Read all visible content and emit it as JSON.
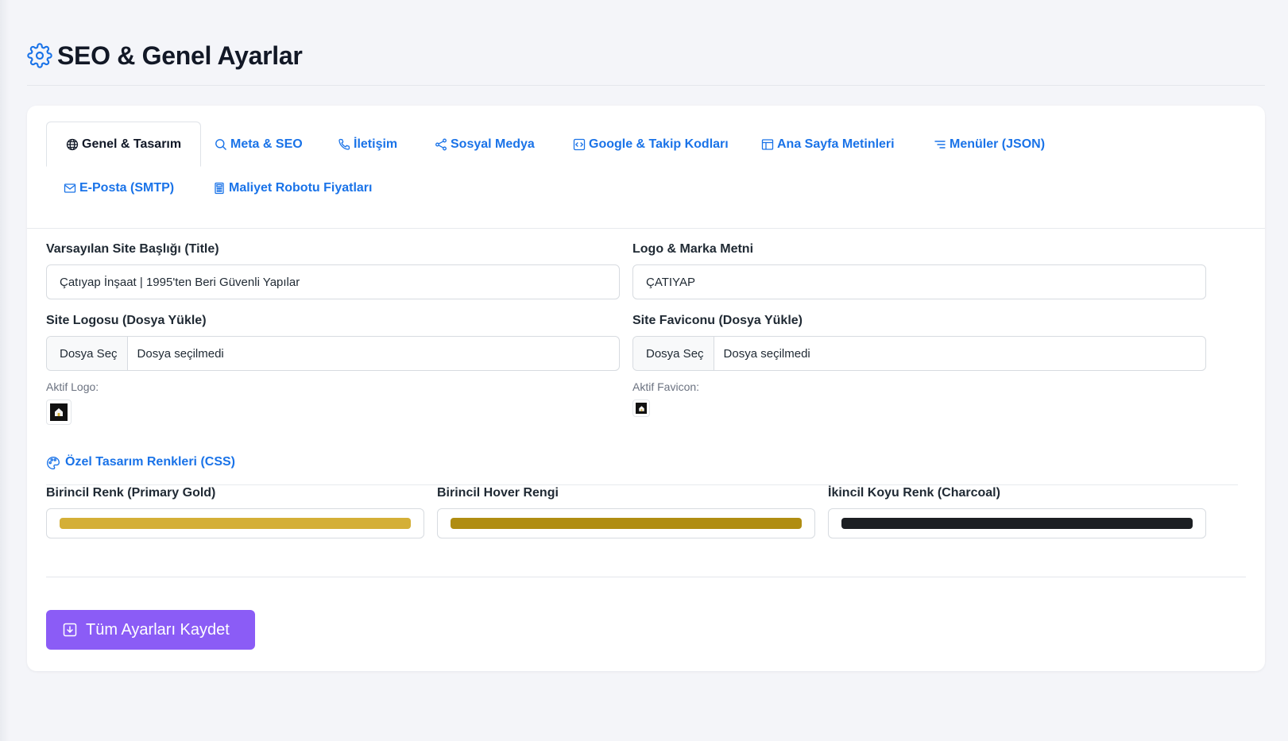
{
  "page": {
    "title": "SEO & Genel Ayarlar",
    "title_icon": "gear-icon"
  },
  "tabs": [
    {
      "label": "Genel & Tasarım",
      "icon": "globe-icon",
      "active": true
    },
    {
      "label": "Meta & SEO",
      "icon": "search-icon",
      "active": false
    },
    {
      "label": "İletişim",
      "icon": "phone-icon",
      "active": false
    },
    {
      "label": "Sosyal Medya",
      "icon": "share-icon",
      "active": false
    },
    {
      "label": "Google & Takip Kodları",
      "icon": "code-icon",
      "active": false
    },
    {
      "label": "Ana Sayfa Metinleri",
      "icon": "layout-icon",
      "active": false
    },
    {
      "label": "Menüler (JSON)",
      "icon": "list-icon",
      "active": false
    },
    {
      "label": "E-Posta (SMTP)",
      "icon": "envelope-icon",
      "active": false
    },
    {
      "label": "Maliyet Robotu Fiyatları",
      "icon": "calculator-icon",
      "active": false
    }
  ],
  "general": {
    "site_title": {
      "label": "Varsayılan Site Başlığı (Title)",
      "value": "Çatıyap İnşaat | 1995'ten Beri Güvenli Yapılar"
    },
    "brand_text": {
      "label": "Logo & Marka Metni",
      "value": "ÇATIYAP"
    },
    "logo_upload": {
      "label": "Site Logosu (Dosya Yükle)",
      "button": "Dosya Seç",
      "file": "Dosya seçilmedi",
      "current_label": "Aktif Logo:"
    },
    "favicon_upload": {
      "label": "Site Faviconu (Dosya Yükle)",
      "button": "Dosya Seç",
      "file": "Dosya seçilmedi",
      "current_label": "Aktif Favicon:"
    }
  },
  "design": {
    "heading": "Özel Tasarım Renkleri (CSS)",
    "heading_icon": "palette-icon",
    "colors": [
      {
        "label": "Birincil Renk (Primary Gold)",
        "value": "#d4af37"
      },
      {
        "label": "Birincil Hover Rengi",
        "value": "#b08d12"
      },
      {
        "label": "İkincil Koyu Renk (Charcoal)",
        "value": "#1c1f23"
      }
    ]
  },
  "actions": {
    "save_label": "Tüm Ayarları Kaydet",
    "save_icon": "save-icon"
  },
  "theme": {
    "accent": "#1a73e8",
    "button": "#8b5cf6"
  }
}
